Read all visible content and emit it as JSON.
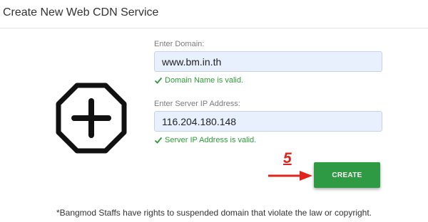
{
  "header": {
    "title": "Create New Web CDN Service"
  },
  "form": {
    "domain_label": "Enter Domain:",
    "domain_value": "www.bm.in.th",
    "domain_valid": "Domain Name is valid.",
    "ip_label": "Enter Server IP Address:",
    "ip_value": "116.204.180.148",
    "ip_valid": "Server IP Address is valid.",
    "create_label": "CREATE"
  },
  "annotation": {
    "step": "5"
  },
  "footer": {
    "disclaimer": "*Bangmod Staffs have rights to suspended domain that violate the law or copyright."
  },
  "icons": {
    "main": "plus-octagon-icon",
    "check": "check-icon",
    "arrow": "arrow-right-icon"
  },
  "colors": {
    "accent": "#2f9a44",
    "valid": "#2e9b3a",
    "annotation": "#e0231b",
    "input_bg": "#e8f0fe"
  }
}
